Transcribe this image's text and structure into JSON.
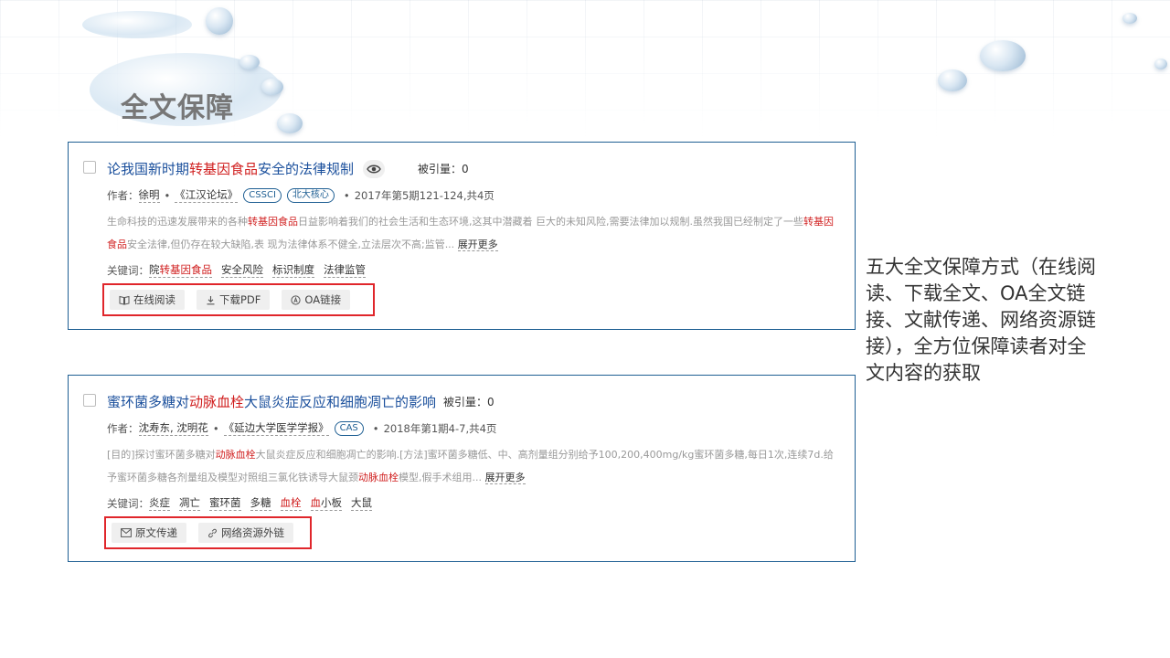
{
  "page": {
    "title": "全文保障"
  },
  "side_note": "五大全文保障方式（在线阅读、下载全文、OA全文链接、文献传递、网络资源链接），全方位保障读者对全文内容的获取",
  "cards": [
    {
      "title_parts": [
        "论我国新时期",
        "转基因食品",
        "安全的法律规制"
      ],
      "cite_label": "被引量：0",
      "author_label": "作者：",
      "authors": "徐明",
      "journal": "《江汉论坛》",
      "tags": [
        "CSSCI",
        "北大核心"
      ],
      "issue": "2017年第5期121-124,共4页",
      "abstract_parts": [
        "生命科技的迅速发展带来的各种",
        "转基因食品",
        "日益影响着我们的社会生活和生态环境,这其中潜藏着 巨大的未知风险,需要法律加以规制.虽然我国已经制定了一些",
        "转基因食品",
        "安全法律,但仍存在较大缺陷,表 现为法律体系不健全,立法层次不高;监管..."
      ],
      "more_label": "展开更多",
      "keyword_label": "关键词：",
      "keywords": [
        {
          "parts": [
            "院",
            "转基因食品"
          ]
        },
        {
          "parts": [
            "安全风险"
          ]
        },
        {
          "parts": [
            "标识制度"
          ]
        },
        {
          "parts": [
            "法律监管"
          ]
        }
      ],
      "buttons": [
        {
          "label": "在线阅读",
          "icon": "book-icon"
        },
        {
          "label": "下载PDF",
          "icon": "download-icon"
        },
        {
          "label": "OA链接",
          "icon": "oa-icon"
        }
      ]
    },
    {
      "title_parts": [
        "蜜环菌多糖对",
        "动脉血栓",
        "大鼠炎症反应和细胞凋亡的影响"
      ],
      "cite_label": "被引量：0",
      "author_label": "作者：",
      "authors": "沈寿东, 沈明花",
      "journal": "《延边大学医学学报》",
      "tags": [
        "CAS"
      ],
      "issue": "2018年第1期4-7,共4页",
      "abstract_parts": [
        "[目的]探讨蜜环菌多糖对",
        "动脉血栓",
        "大鼠炎症反应和细胞凋亡的影响.[方法]蜜环菌多糖低、中、高剂量组分别给予100,200,400mg/kg蜜环菌多糖,每日1次,连续7d.给予蜜环菌多糖各剂量组及模型对照组三氯化铁诱导大鼠颈",
        "动脉血栓",
        "模型,假手术组用..."
      ],
      "more_label": "展开更多",
      "keyword_label": "关键词：",
      "keywords": [
        "炎症",
        "凋亡",
        "蜜环菌",
        "多糖",
        "血栓",
        "血小板",
        "大鼠"
      ],
      "buttons": [
        {
          "label": "原文传递",
          "icon": "mail-icon"
        },
        {
          "label": "网络资源外链",
          "icon": "link-icon"
        }
      ]
    }
  ],
  "colors": {
    "title_blue": "#1a4f9c",
    "highlight_red": "#d01f1f",
    "card_border": "#1f5f93",
    "box_red": "#e0262b"
  }
}
